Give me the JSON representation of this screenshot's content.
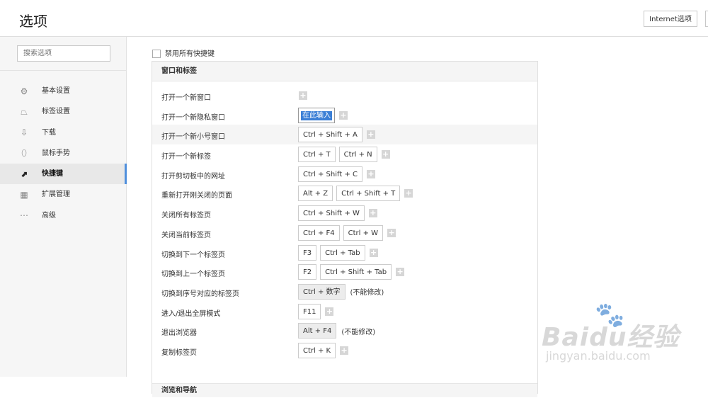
{
  "header": {
    "title": "选项",
    "internet_options": "Internet选项"
  },
  "sidebar": {
    "search_placeholder": "搜索选项",
    "items": [
      {
        "label": "基本设置",
        "icon": "gear-icon"
      },
      {
        "label": "标签设置",
        "icon": "tab-icon"
      },
      {
        "label": "下载",
        "icon": "download-icon"
      },
      {
        "label": "鼠标手势",
        "icon": "mouse-icon"
      },
      {
        "label": "快捷键",
        "icon": "shortcut-icon",
        "active": true
      },
      {
        "label": "扩展管理",
        "icon": "extensions-icon"
      },
      {
        "label": "高级",
        "icon": "more-icon"
      }
    ]
  },
  "main": {
    "disable_all": "禁用所有快捷键",
    "section_title": "窗口和标签",
    "next_section_title": "浏览和导航",
    "plus": "+",
    "rows": [
      {
        "label": "打开一个新窗口",
        "keys": [],
        "note": ""
      },
      {
        "label": "打开一个新隐私窗口",
        "editing": "在此输入",
        "keys": [],
        "note": ""
      },
      {
        "label": "打开一个新小号窗口",
        "keys": [
          "Ctrl + Shift + A"
        ],
        "note": ""
      },
      {
        "label": "打开一个新标签",
        "keys": [
          "Ctrl + T",
          "Ctrl + N"
        ],
        "note": ""
      },
      {
        "label": "打开剪切板中的网址",
        "keys": [
          "Ctrl + Shift + C"
        ],
        "note": ""
      },
      {
        "label": "重新打开刚关闭的页面",
        "keys": [
          "Alt + Z",
          "Ctrl + Shift + T"
        ],
        "note": ""
      },
      {
        "label": "关闭所有标签页",
        "keys": [
          "Ctrl + Shift + W"
        ],
        "note": ""
      },
      {
        "label": "关闭当前标签页",
        "keys": [
          "Ctrl + F4",
          "Ctrl + W"
        ],
        "note": ""
      },
      {
        "label": "切换到下一个标签页",
        "keys": [
          "F3",
          "Ctrl + Tab"
        ],
        "note": ""
      },
      {
        "label": "切换到上一个标签页",
        "keys": [
          "F2",
          "Ctrl + Shift + Tab"
        ],
        "note": ""
      },
      {
        "label": "切换到序号对应的标签页",
        "keys": [
          "Ctrl + 数字"
        ],
        "fixed": true,
        "note": "(不能修改)"
      },
      {
        "label": "进入/退出全屏模式",
        "keys": [
          "F11"
        ],
        "note": ""
      },
      {
        "label": "退出浏览器",
        "keys": [
          "Alt + F4"
        ],
        "fixed": true,
        "note": "(不能修改)"
      },
      {
        "label": "复制标签页",
        "keys": [
          "Ctrl + K"
        ],
        "note": ""
      }
    ]
  },
  "watermark": {
    "main": "Baidu经验",
    "sub": "jingyan.baidu.com"
  }
}
